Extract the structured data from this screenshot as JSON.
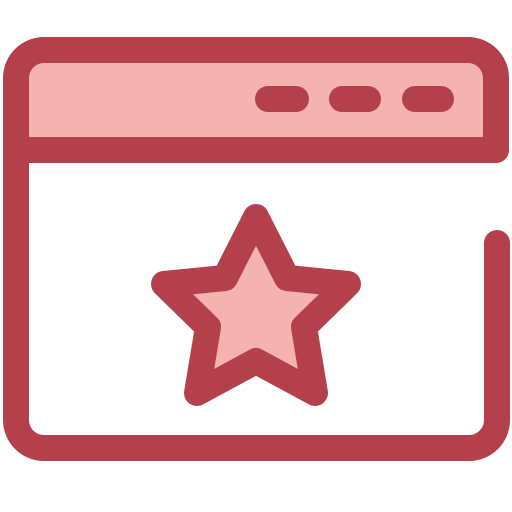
{
  "icon": {
    "name": "browser-window-star-icon",
    "stroke_color": "#b3404a",
    "fill_color": "#f4b2b0",
    "background_color": "#ffffff"
  },
  "title_bar": {
    "controls": [
      "window-control-dot-icon",
      "window-control-dot-icon",
      "window-control-dot-icon"
    ]
  },
  "content": {
    "symbol": "star-icon"
  }
}
